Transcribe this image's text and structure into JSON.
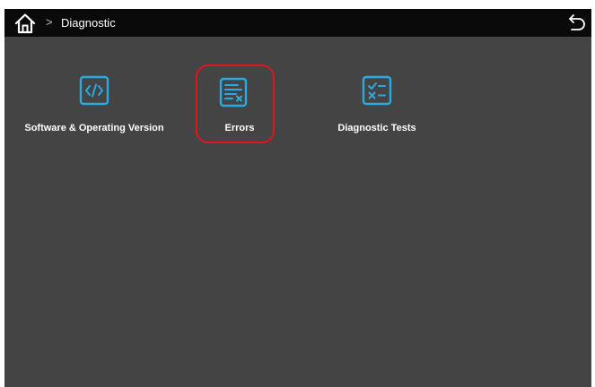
{
  "topbar": {
    "home_icon": "home-icon",
    "breadcrumb_separator": ">",
    "breadcrumb_title": "Diagnostic",
    "back_icon": "back-arrow-icon"
  },
  "tiles": [
    {
      "label": "Software & Operating Version",
      "icon": "code-icon",
      "selected": false
    },
    {
      "label": "Errors",
      "icon": "error-list-icon",
      "selected": true
    },
    {
      "label": "Diagnostic Tests",
      "icon": "checklist-icon",
      "selected": false
    }
  ],
  "colors": {
    "background": "#444444",
    "topbar": "#0a0a0a",
    "icon_accent": "#2ba9e1",
    "selection_outline": "#e0141b",
    "text": "#ffffff"
  }
}
